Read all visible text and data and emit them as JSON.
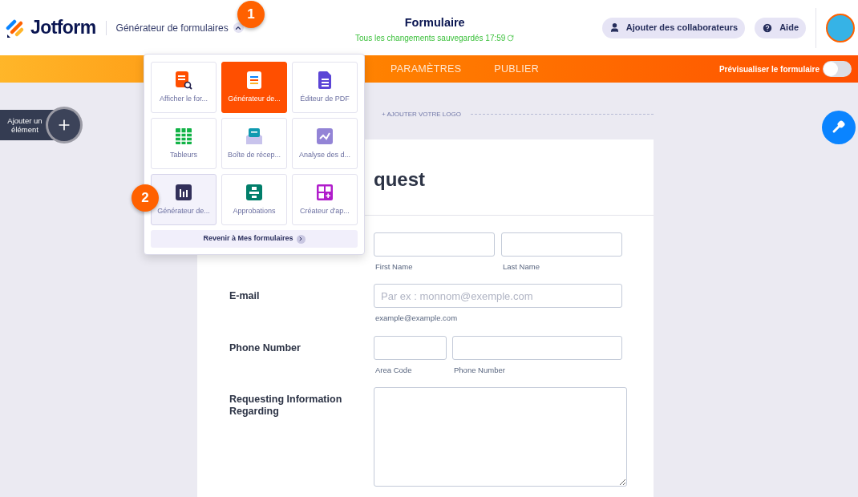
{
  "header": {
    "brand": "Jotform",
    "product_menu": {
      "label": "Générateur de formulaires",
      "expanded": true
    },
    "title": "Formulaire",
    "save_status": "Tous les changements sauvegardés 17:59",
    "buttons": [
      {
        "label": "Ajouter des collaborateurs"
      },
      {
        "label": "Aide"
      }
    ]
  },
  "nav": {
    "tabs": [
      {
        "label": "PARAMÈTRES",
        "selected": false
      },
      {
        "label": "PUBLIER",
        "selected": false
      }
    ],
    "preview": {
      "label": "Prévisualiser le formulaire",
      "on": false
    }
  },
  "product_popup": {
    "tiles": [
      {
        "label": "Afficher le for...",
        "selected": false,
        "hovered": false
      },
      {
        "label": "Générateur de...",
        "selected": true,
        "hovered": false
      },
      {
        "label": "Éditeur de PDF",
        "selected": false,
        "hovered": false
      },
      {
        "label": "Tableurs",
        "selected": false,
        "hovered": false
      },
      {
        "label": "Boîte de récep...",
        "selected": false,
        "hovered": false
      },
      {
        "label": "Analyse des d...",
        "selected": false,
        "hovered": false
      },
      {
        "label": "Générateur de...",
        "selected": false,
        "hovered": true
      },
      {
        "label": "Approbations",
        "selected": false,
        "hovered": false
      },
      {
        "label": "Créateur d'ap...",
        "selected": false,
        "hovered": false
      }
    ],
    "footer": "Revenir à Mes formulaires"
  },
  "callouts": [
    "1",
    "2"
  ],
  "add_element": "Ajouter un élément",
  "logo_link": "+ AJOUTER VOTRE LOGO",
  "form": {
    "title": "quest",
    "fields": [
      {
        "kind": "split",
        "inputs": [
          {
            "sublabel": "First Name"
          },
          {
            "sublabel": "Last Name"
          }
        ]
      },
      {
        "kind": "single",
        "label": "E-mail",
        "inputs": [
          {
            "sublabel": "example@example.com",
            "placeholder": "Par ex : monnom@exemple.com"
          }
        ]
      },
      {
        "kind": "phone",
        "label": "Phone Number",
        "inputs": [
          {
            "sublabel": "Area Code"
          },
          {
            "sublabel": "Phone Number"
          }
        ]
      },
      {
        "kind": "textarea",
        "label": "Requesting Information Regarding"
      }
    ]
  }
}
